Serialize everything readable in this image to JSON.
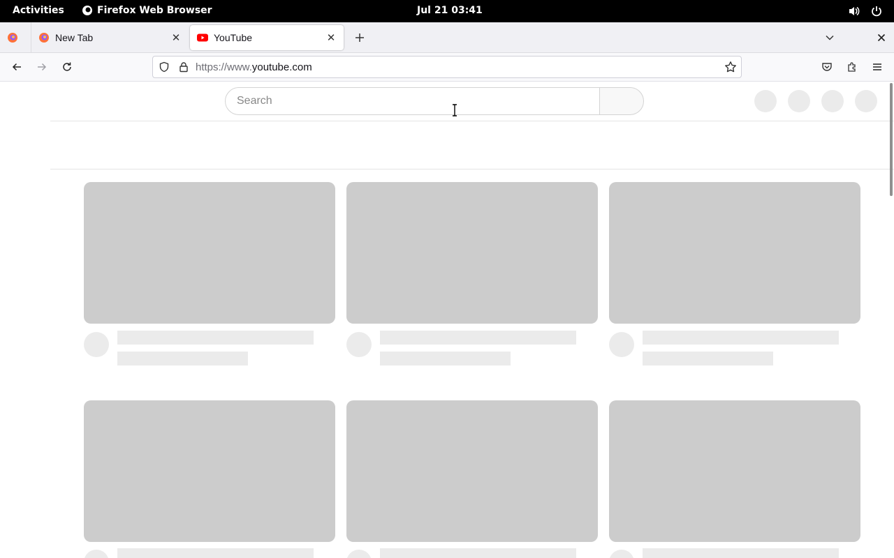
{
  "topbar": {
    "activities": "Activities",
    "app_name": "Firefox Web Browser",
    "clock": "Jul 21  03:41"
  },
  "tabs": [
    {
      "title": "New Tab",
      "favicon": "firefox-icon",
      "active": false
    },
    {
      "title": "YouTube",
      "favicon": "youtube-icon",
      "active": true
    }
  ],
  "navbar": {
    "url_prefix": "https://www.",
    "url_domain": "youtube.com"
  },
  "page": {
    "search_placeholder": "Search"
  },
  "colors": {
    "skeleton_thumb": "#cccccc",
    "skeleton_line": "#ebebeb",
    "youtube_red": "#ff0000"
  }
}
